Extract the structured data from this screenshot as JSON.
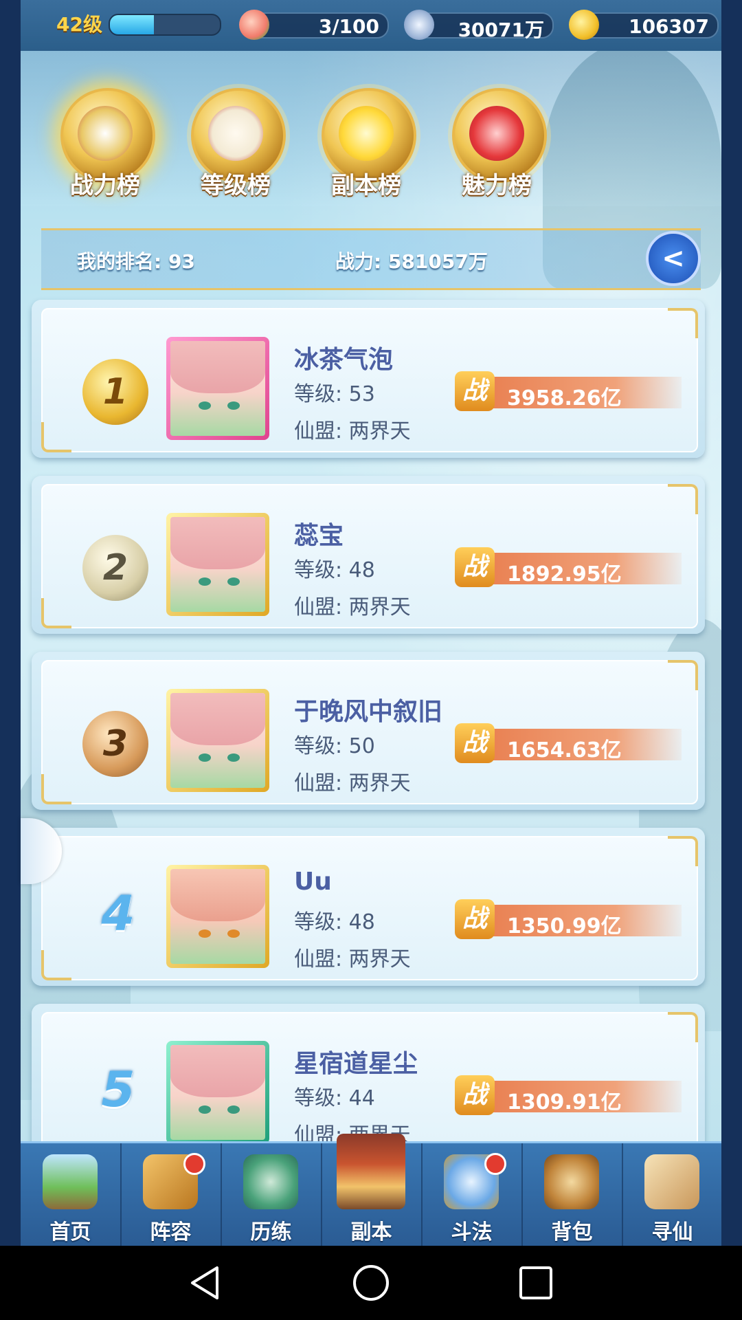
{
  "topbar": {
    "level": "42级",
    "level_progress": 0.4,
    "stamina": "3/100",
    "silver": "30071万",
    "gold": "106307"
  },
  "tabs": [
    {
      "label": "战力榜",
      "active": true
    },
    {
      "label": "等级榜",
      "active": false
    },
    {
      "label": "副本榜",
      "active": false
    },
    {
      "label": "魅力榜",
      "active": false
    }
  ],
  "my_rank": {
    "rank_text": "我的排名: 93",
    "power_text": "战力: 581057万"
  },
  "power_badge": "战",
  "entries": [
    {
      "rank": "1",
      "name": "冰茶气泡",
      "level": "等级: 53",
      "guild": "仙盟: 两界天",
      "power": "3958.26亿"
    },
    {
      "rank": "2",
      "name": "蕊宝",
      "level": "等级: 48",
      "guild": "仙盟: 两界天",
      "power": "1892.95亿"
    },
    {
      "rank": "3",
      "name": "于晚风中叙旧",
      "level": "等级: 50",
      "guild": "仙盟: 两界天",
      "power": "1654.63亿"
    },
    {
      "rank": "4",
      "name": "Uu",
      "level": "等级: 48",
      "guild": "仙盟: 两界天",
      "power": "1350.99亿"
    },
    {
      "rank": "5",
      "name": "星宿道星尘",
      "level": "等级: 44",
      "guild": "仙盟: 两界天",
      "power": "1309.91亿"
    }
  ],
  "nav": [
    {
      "label": "首页",
      "badge": false
    },
    {
      "label": "阵容",
      "badge": true
    },
    {
      "label": "历练",
      "badge": false
    },
    {
      "label": "副本",
      "badge": false
    },
    {
      "label": "斗法",
      "badge": true
    },
    {
      "label": "背包",
      "badge": false
    },
    {
      "label": "寻仙",
      "badge": false
    }
  ],
  "colors": {
    "accent_gold": "#e6c46a",
    "name_blue": "#4b5fa3",
    "power_orange": "#e87a4a",
    "badge_red": "#e23b2f"
  }
}
